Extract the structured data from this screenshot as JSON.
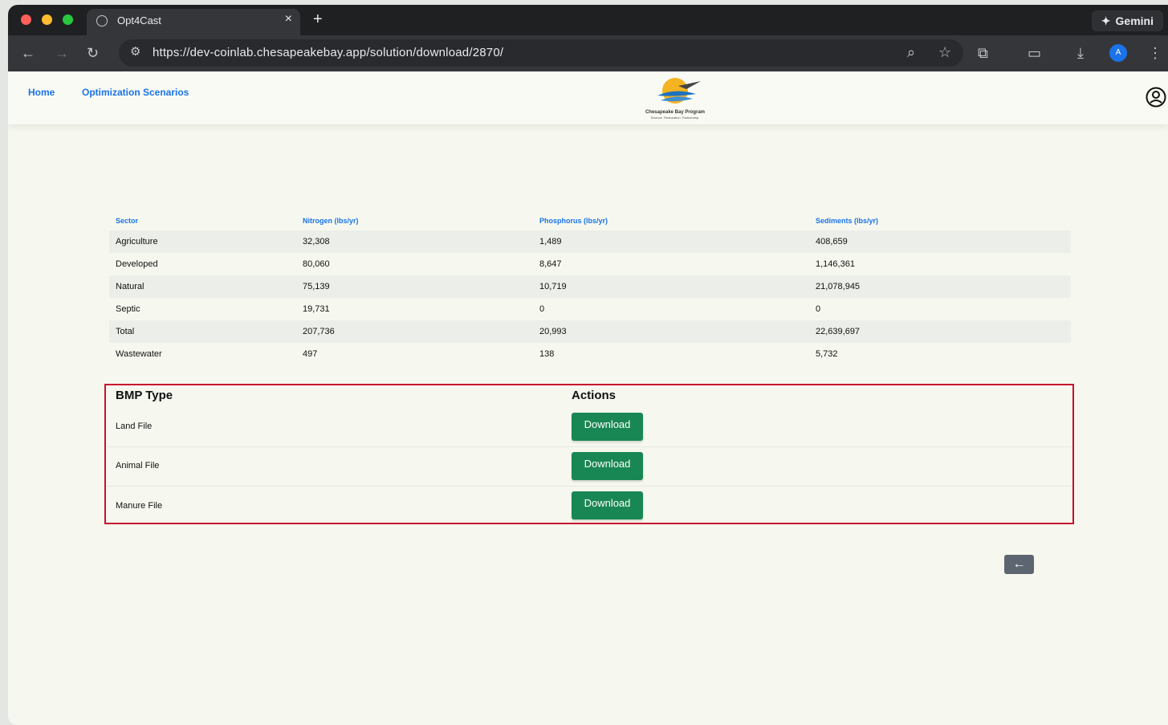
{
  "browser": {
    "tab_title": "Opt4Cast",
    "tab_close": "×",
    "new_tab": "+",
    "gemini_label": "Gemini",
    "url": "https://dev-coinlab.chesapeakebay.app/solution/download/2870/",
    "profile_initial": "A"
  },
  "nav": {
    "home": "Home",
    "scenarios": "Optimization Scenarios",
    "logo_text": "Chesapeake Bay Program",
    "logo_tagline": "Science. Restoration. Partnership."
  },
  "summary_table": {
    "headers": [
      "Sector",
      "Nitrogen (lbs/yr)",
      "Phosphorus (lbs/yr)",
      "Sediments (lbs/yr)"
    ],
    "rows": [
      [
        "Agriculture",
        "32,308",
        "1,489",
        "408,659"
      ],
      [
        "Developed",
        "80,060",
        "8,647",
        "1,146,361"
      ],
      [
        "Natural",
        "75,139",
        "10,719",
        "21,078,945"
      ],
      [
        "Septic",
        "19,731",
        "0",
        "0"
      ],
      [
        "Total",
        "207,736",
        "20,993",
        "22,639,697"
      ],
      [
        "Wastewater",
        "497",
        "138",
        "5,732"
      ]
    ]
  },
  "bmp_table": {
    "header_type": "BMP Type",
    "header_actions": "Actions",
    "rows": [
      {
        "label": "Land File",
        "button": "Download"
      },
      {
        "label": "Animal File",
        "button": "Download"
      },
      {
        "label": "Manure File",
        "button": "Download"
      }
    ]
  },
  "colors": {
    "link": "#1a73e8",
    "download_button": "#198754",
    "highlight_border": "#c8102e",
    "back_button": "#5d6670"
  }
}
